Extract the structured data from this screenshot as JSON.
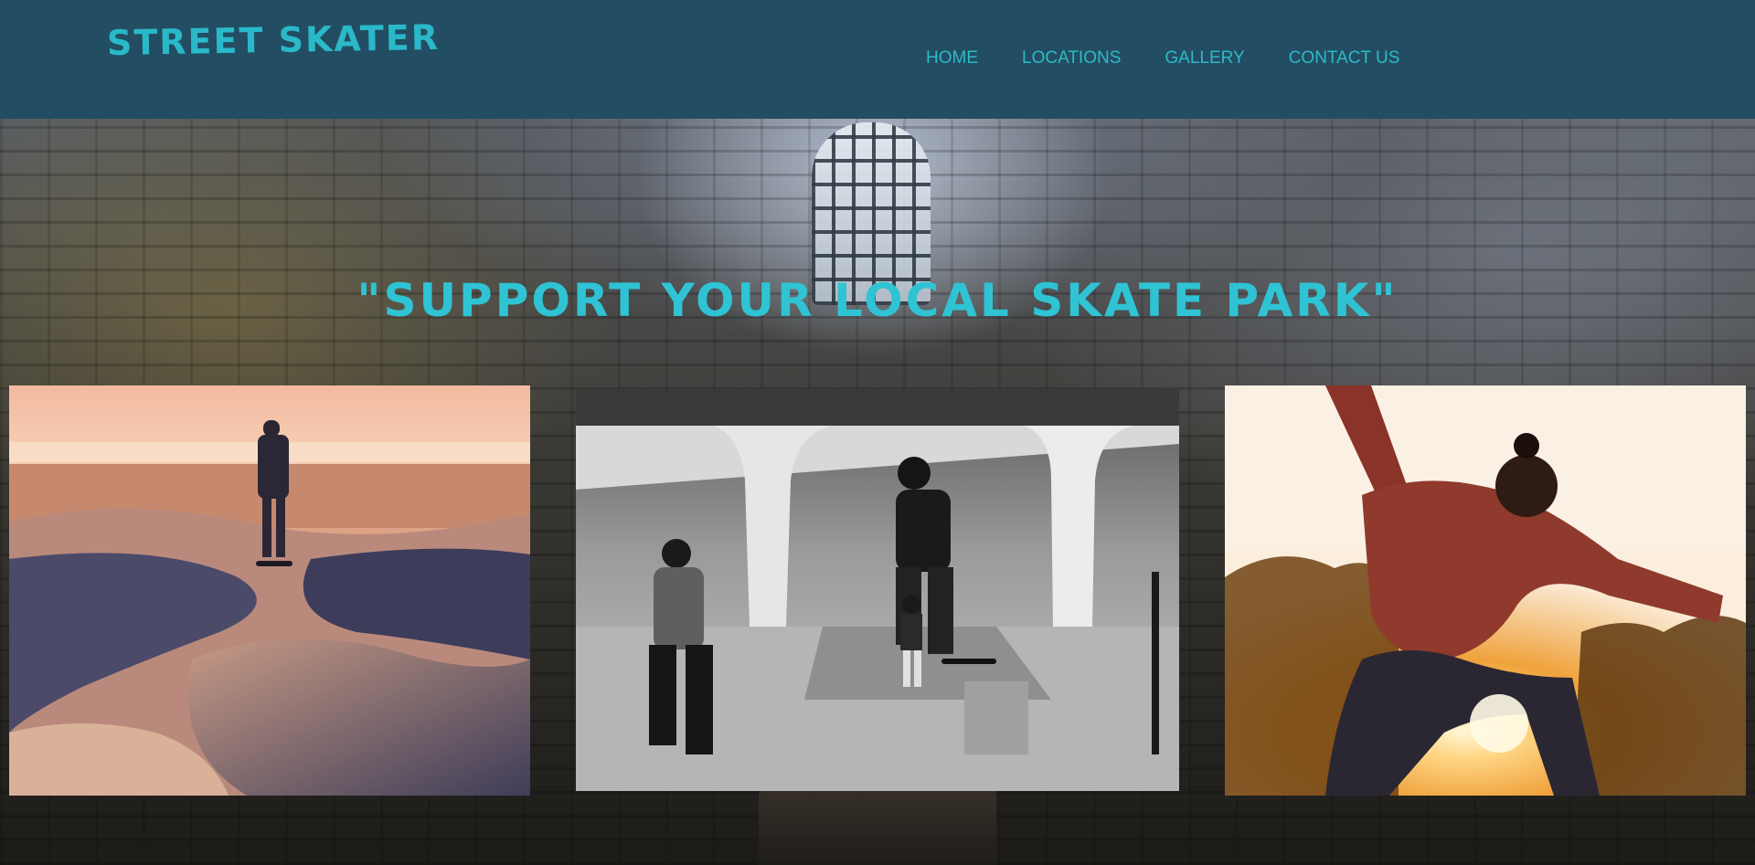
{
  "header": {
    "logo": "STREET SKATER",
    "nav": [
      "HOME",
      "LOCATIONS",
      "GALLERY",
      "CONTACT US"
    ]
  },
  "hero": {
    "tagline": "\"SUPPORT YOUR LOCAL SKATE PARK\""
  },
  "gallery": {
    "photos": [
      {
        "name": "skater at beach skate park at sunset"
      },
      {
        "name": "black and white skaters under overpass"
      },
      {
        "name": "skater jumping at sunset"
      }
    ]
  },
  "colors": {
    "header_bg": "#234d62",
    "accent": "#2cbac9"
  }
}
